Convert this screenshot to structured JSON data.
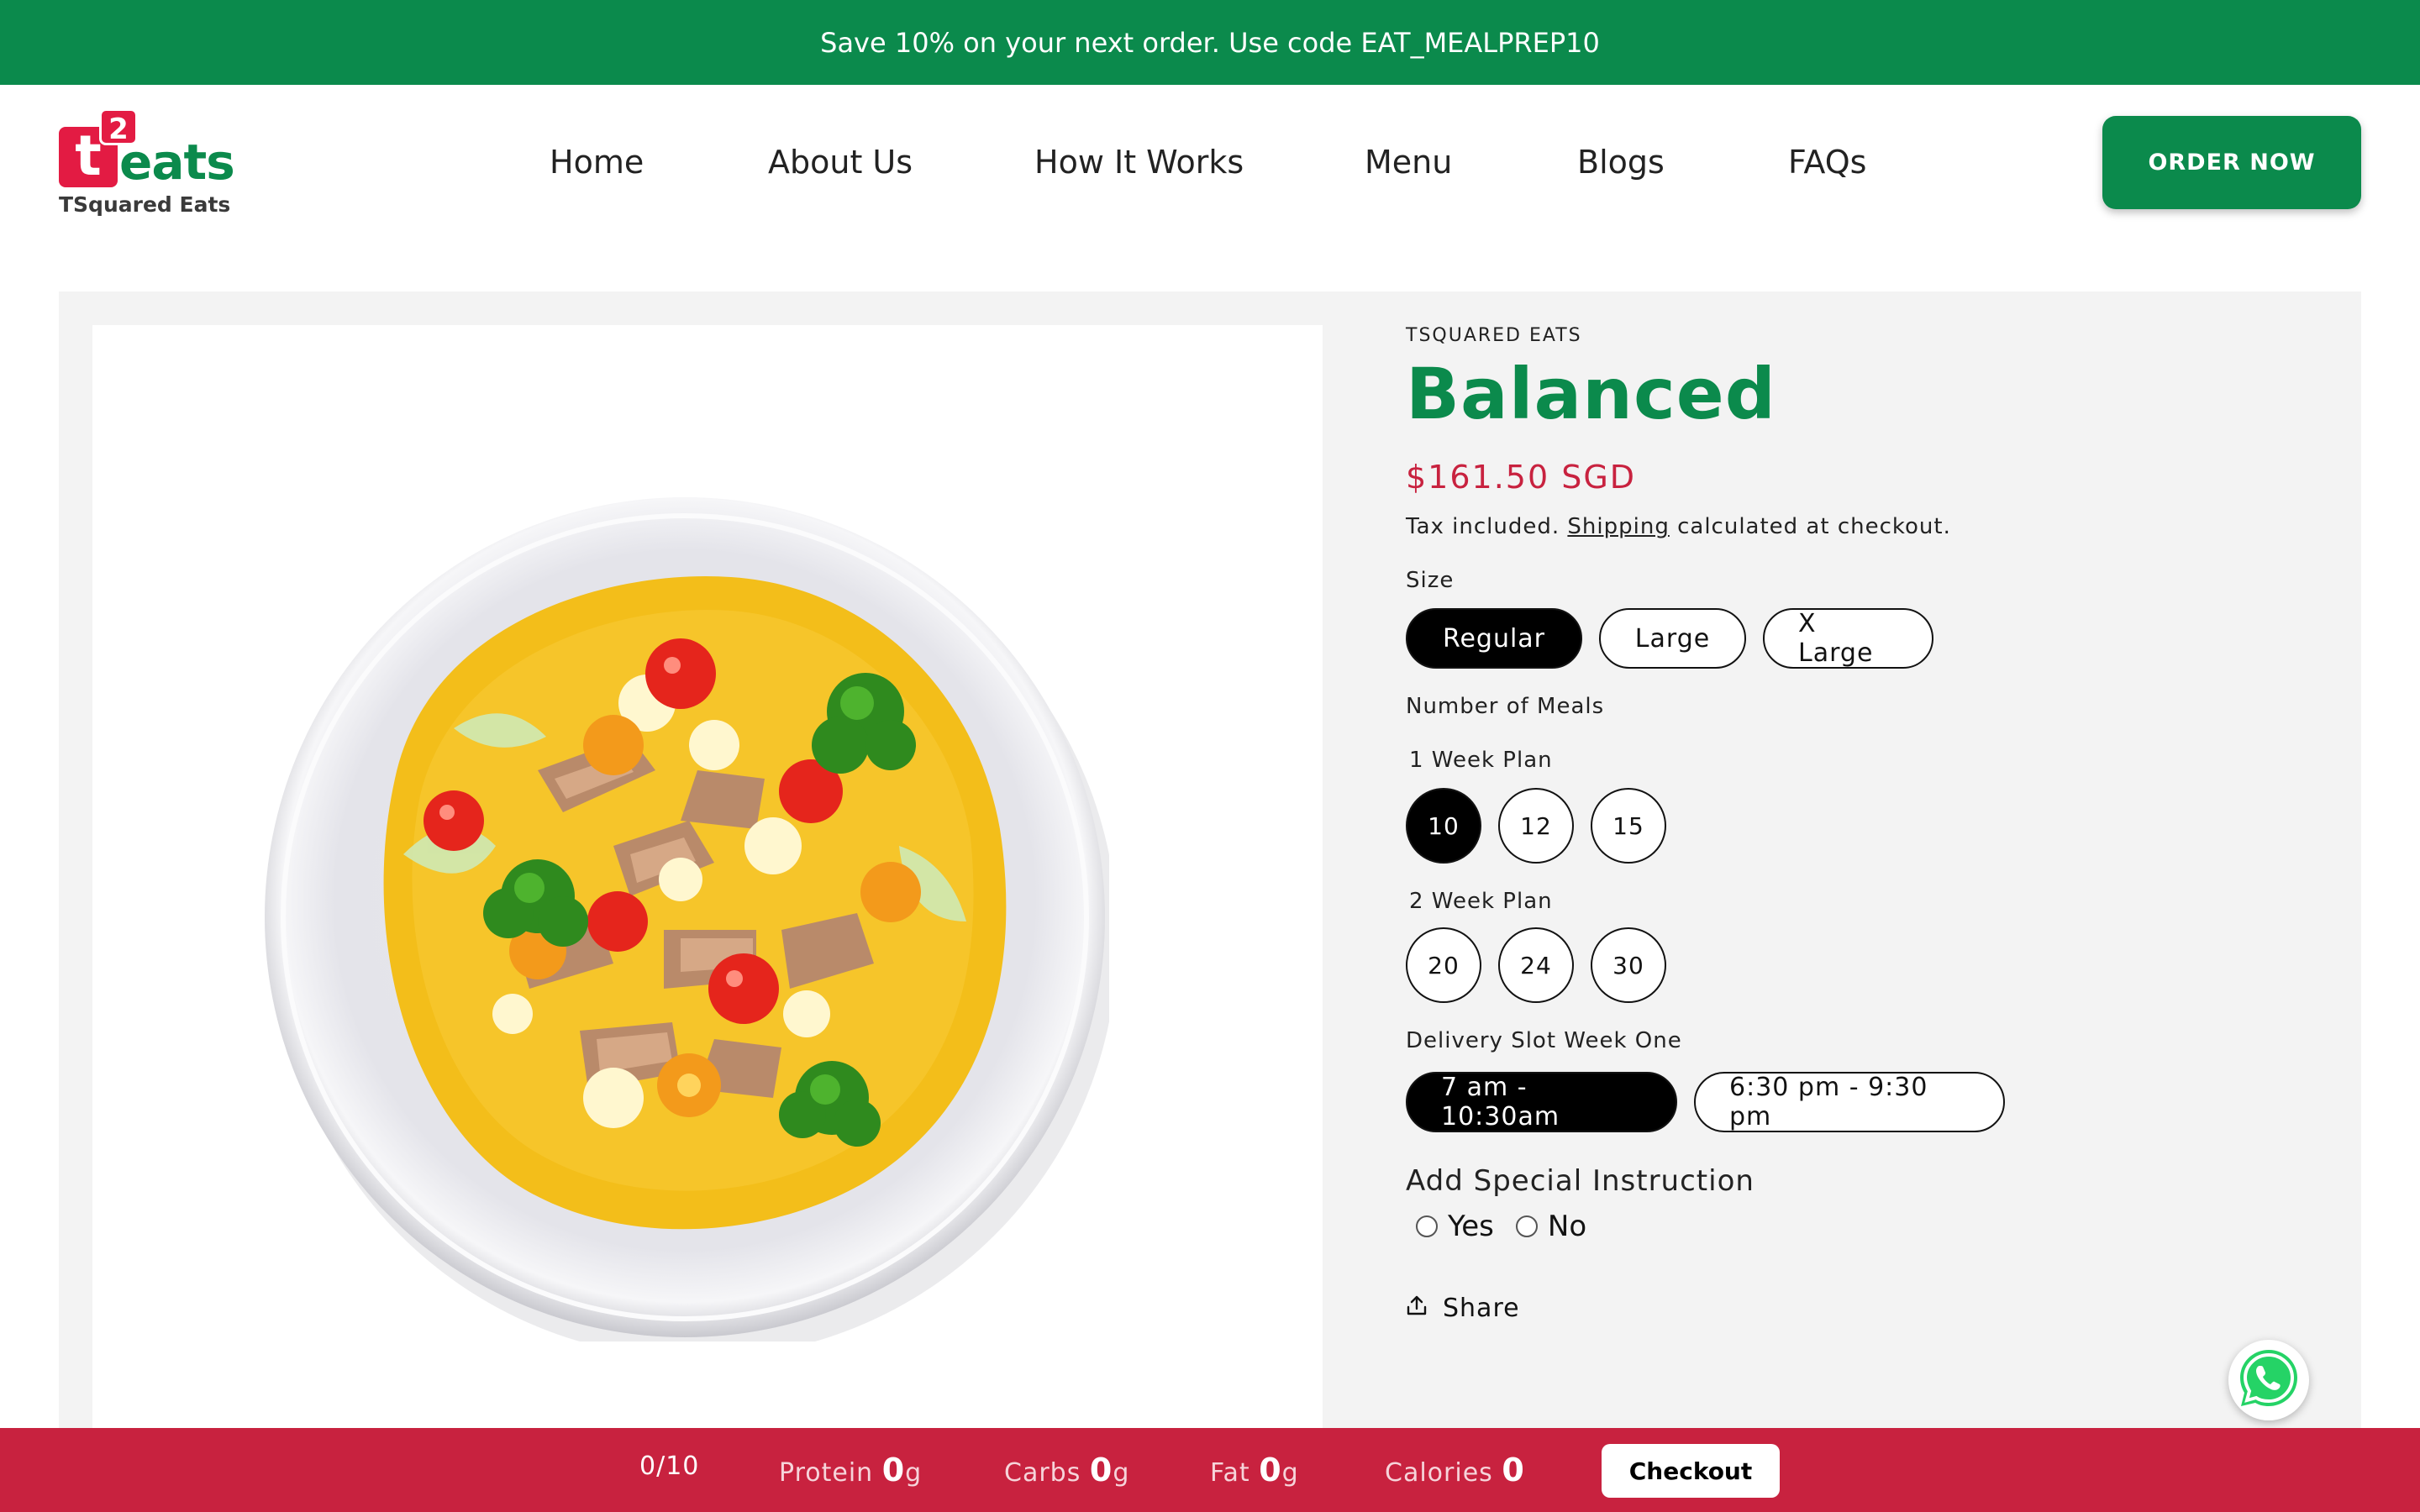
{
  "announcement": "Save 10% on your next order. Use code EAT_MEALPREP10",
  "brand": {
    "mark": "t",
    "superscript": "2",
    "wordmark": "eats",
    "tagline": "TSquared Eats"
  },
  "nav": [
    "Home",
    "About Us",
    "How It Works",
    "Menu",
    "Blogs",
    "FAQs"
  ],
  "cta": "ORDER NOW",
  "product": {
    "vendor": "TSQUARED EATS",
    "title": "Balanced",
    "price": "$161.50 SGD",
    "tax_prefix": "Tax included.",
    "tax_link": "Shipping",
    "tax_suffix": "calculated at checkout.",
    "size": {
      "label": "Size",
      "options": [
        "Regular",
        "Large",
        "X Large"
      ],
      "selected": "Regular"
    },
    "meals": {
      "label": "Number of Meals",
      "week1": {
        "label": "1 Week Plan",
        "options": [
          "10",
          "12",
          "15"
        ],
        "selected": "10"
      },
      "week2": {
        "label": "2 Week Plan",
        "options": [
          "20",
          "24",
          "30"
        ]
      }
    },
    "delivery": {
      "label": "Delivery Slot Week One",
      "options": [
        "7 am - 10:30am",
        "6:30 pm - 9:30 pm"
      ],
      "selected": "7 am - 10:30am"
    },
    "special": {
      "label": "Add Special Instruction",
      "yes": "Yes",
      "no": "No"
    },
    "share": "Share"
  },
  "bottom_bar": {
    "count": "0/10",
    "protein_label": "Protein",
    "protein_value": "0",
    "protein_unit": "g",
    "carbs_label": "Carbs",
    "carbs_value": "0",
    "carbs_unit": "g",
    "fat_label": "Fat",
    "fat_value": "0",
    "fat_unit": "g",
    "calories_label": "Calories",
    "calories_value": "0",
    "checkout": "Checkout"
  },
  "colors": {
    "brand_green": "#0b8a4c",
    "brand_red": "#c8223f",
    "logo_red": "#e31b43"
  },
  "icons": [
    "share-icon",
    "whatsapp-icon",
    "radio-icon"
  ]
}
